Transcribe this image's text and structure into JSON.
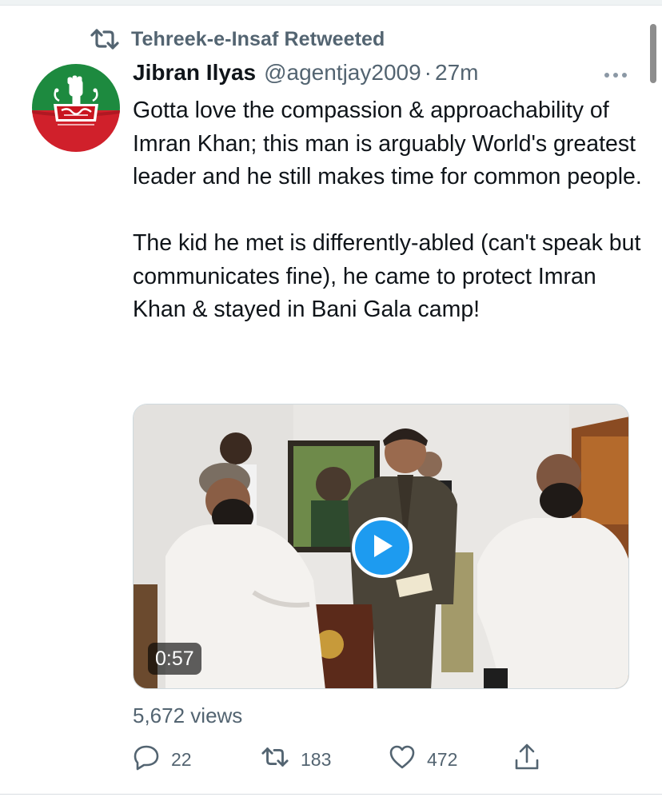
{
  "retweet": {
    "icon": "retweet-icon",
    "text": "Tehreek-e-Insaf Retweeted"
  },
  "tweet": {
    "author_name": "Jibran Ilyas",
    "handle": "@agentjay2009",
    "separator": "·",
    "time": "27m",
    "more_icon": "more-icon",
    "paragraph1": "Gotta love the compassion & approachability of Imran Khan; this man is arguably World's greatest leader and he still makes time for common people.",
    "paragraph2": "The kid he met is differently-abled (can't speak but communicates fine), he came to protect Imran Khan & stayed in Bani Gala camp!"
  },
  "media": {
    "type": "video",
    "duration": "0:57",
    "play_icon": "play-icon"
  },
  "stats": {
    "views": "5,672 views"
  },
  "actions": {
    "reply": {
      "icon": "reply-icon",
      "count": "22"
    },
    "retweet": {
      "icon": "retweet-icon",
      "count": "183"
    },
    "like": {
      "icon": "heart-icon",
      "count": "472"
    },
    "share": {
      "icon": "share-icon"
    }
  },
  "colors": {
    "muted": "#536471",
    "accent": "#1d9bf0",
    "text": "#0f1419"
  }
}
